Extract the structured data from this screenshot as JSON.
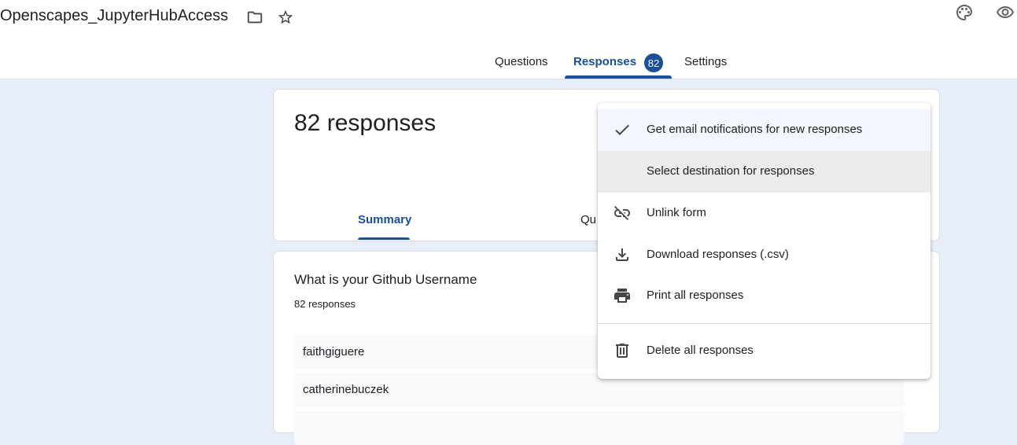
{
  "header": {
    "form_title": "Openscapes_JupyterHubAccess",
    "icons": [
      "folder-icon",
      "star-icon",
      "palette-icon",
      "eye-icon"
    ]
  },
  "main_tabs": [
    {
      "label": "Questions",
      "active": false
    },
    {
      "label": "Responses",
      "active": true,
      "badge": "82"
    },
    {
      "label": "Settings",
      "active": false
    }
  ],
  "summary": {
    "count_label": "82 responses",
    "tabs": [
      {
        "label": "Summary",
        "active": true
      },
      {
        "label": "Qu",
        "active": false
      }
    ]
  },
  "question": {
    "title": "What is your Github Username",
    "count_label": "82 responses",
    "answers": [
      "faithgiguere",
      "catherinebuczek",
      ""
    ]
  },
  "menu": {
    "items": [
      {
        "label": "Get email notifications for new responses",
        "icon": "check-icon",
        "checked": true
      },
      {
        "label": "Select destination for responses",
        "icon": "",
        "hover": true
      },
      {
        "label": "Unlink form",
        "icon": "link-off-icon"
      },
      {
        "label": "Download responses (.csv)",
        "icon": "download-icon"
      },
      {
        "label": "Print all responses",
        "icon": "print-icon"
      },
      {
        "label": "Delete all responses",
        "icon": "trash-icon"
      }
    ]
  },
  "colors": {
    "accent": "#1a4fa0",
    "background": "#e8eef9"
  }
}
